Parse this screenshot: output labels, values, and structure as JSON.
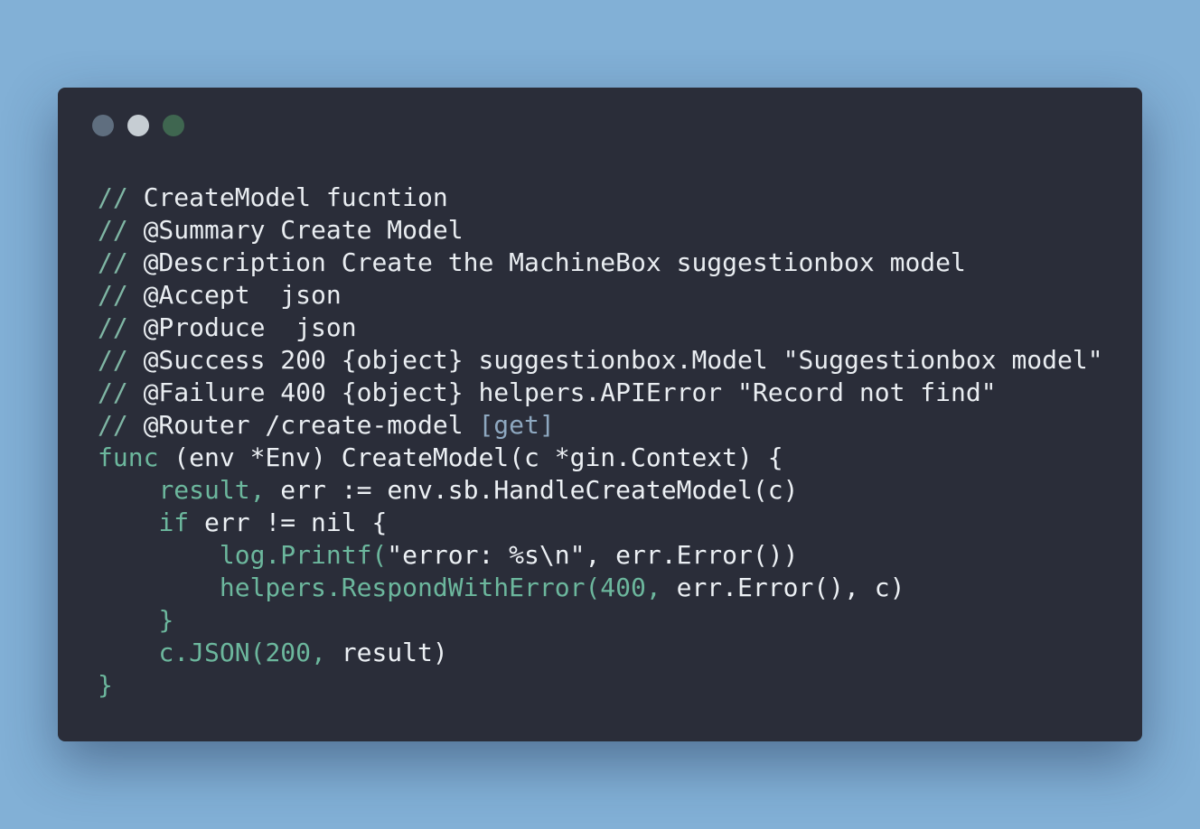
{
  "window": {
    "controls": [
      "close",
      "minimize",
      "maximize"
    ]
  },
  "code": {
    "l1": {
      "a": "//",
      "b": " CreateModel fucntion"
    },
    "l2": {
      "a": "//",
      "b": " @Summary Create Model"
    },
    "l3": {
      "a": "//",
      "b": " @Description Create the MachineBox suggestionbox model"
    },
    "l4": {
      "a": "//",
      "b": " @Accept  json"
    },
    "l5": {
      "a": "//",
      "b": " @Produce  json"
    },
    "l6": {
      "a": "//",
      "b": " @Success 200 {object} suggestionbox.Model \"Suggestionbox model\""
    },
    "l7": {
      "a": "//",
      "b": " @Failure 400 {object} helpers.APIError \"Record not find\""
    },
    "l8": {
      "a": "//",
      "b": " @Router /create-model ",
      "c": "[get]"
    },
    "l9": {
      "a": "func",
      "b": " (env *Env) CreateModel(c *gin.Context) {"
    },
    "l10": {
      "indent": "    ",
      "a": "result,",
      "b": " err := env.sb.HandleCreateModel(c)"
    },
    "l11": {
      "indent": "    ",
      "a": "if",
      "b": " err != nil {"
    },
    "l12": {
      "indent": "        ",
      "a": "log.Printf(",
      "b": "\"error: %s\\n\", err.Error())"
    },
    "l13": {
      "indent": "        ",
      "a": "helpers.RespondWithError(400,",
      "b": " err.Error(), c)"
    },
    "l14": {
      "indent": "    ",
      "a": "}"
    },
    "l15": {
      "indent": "    ",
      "a": "c.JSON(200,",
      "b": " result)"
    },
    "l16": {
      "a": "}"
    }
  },
  "colors": {
    "background": "#82b0d6",
    "window": "#2a2d39",
    "text": "#ecf0f4",
    "accent_teal": "#6cb79d"
  }
}
